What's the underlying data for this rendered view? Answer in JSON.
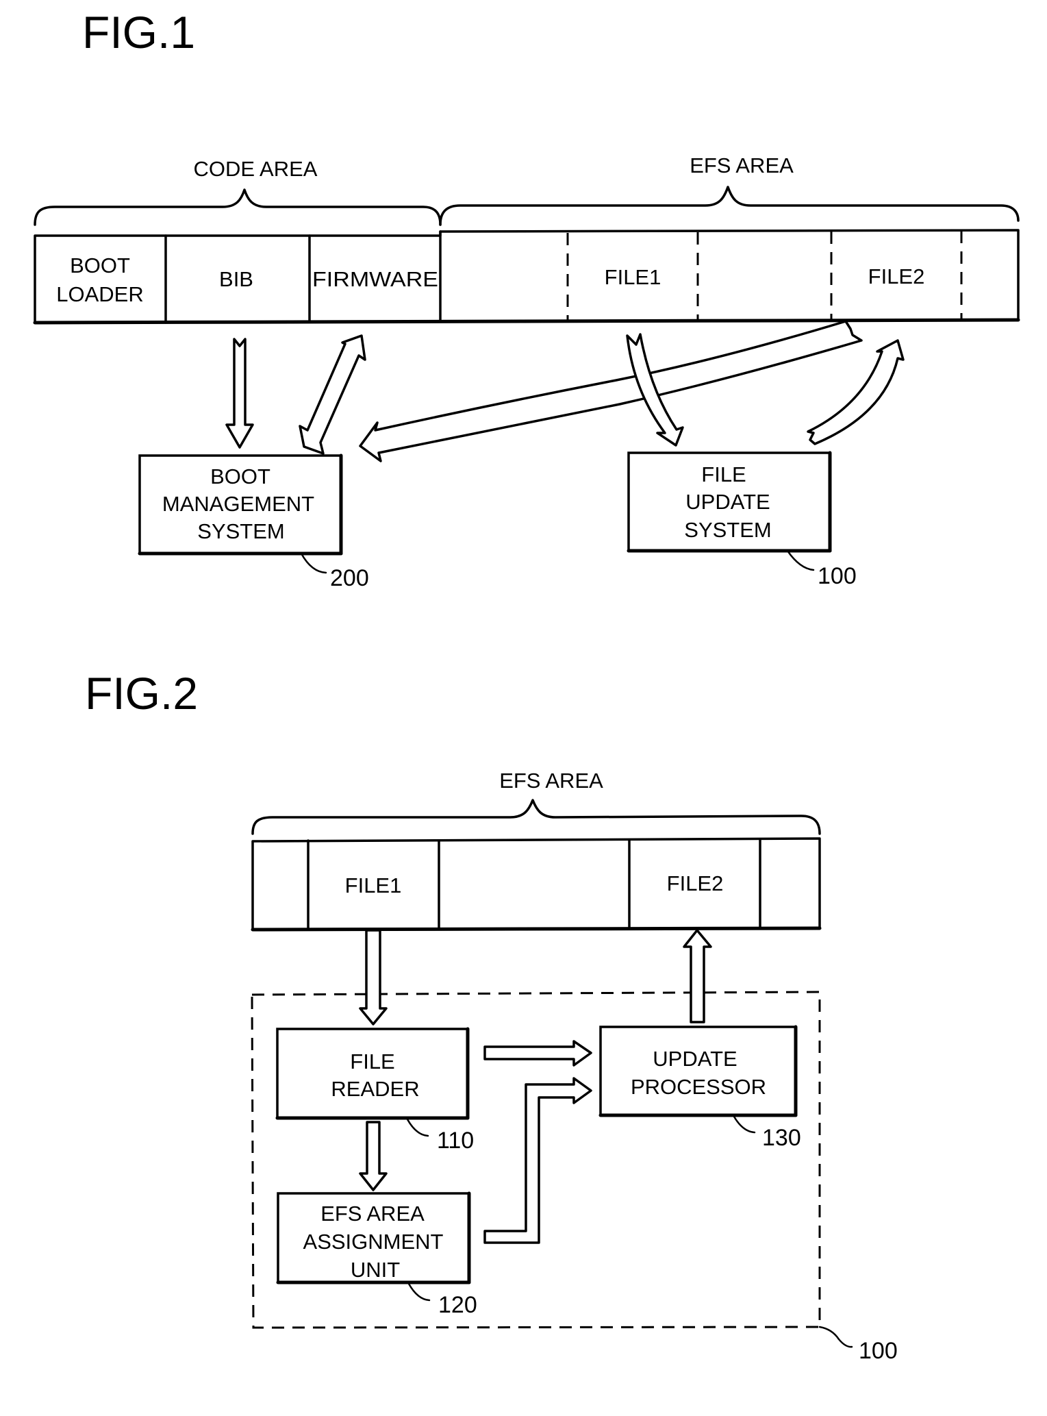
{
  "fig1": {
    "title": "FIG.1",
    "code_area_label": "CODE AREA",
    "efs_area_label": "EFS AREA",
    "code_segments": [
      {
        "lines": [
          "BOOT",
          "LOADER"
        ]
      },
      {
        "lines": [
          "BIB"
        ]
      },
      {
        "lines": [
          "FIRMWARE"
        ]
      }
    ],
    "efs_segments": [
      "",
      "FILE1",
      "",
      "FILE2",
      ""
    ],
    "boot_management_box": {
      "lines": [
        "BOOT",
        "MANAGEMENT",
        "SYSTEM"
      ],
      "ref": "200"
    },
    "file_update_box": {
      "lines": [
        "FILE",
        "UPDATE",
        "SYSTEM"
      ],
      "ref": "100"
    }
  },
  "fig2": {
    "title": "FIG.2",
    "efs_area_label": "EFS AREA",
    "efs_segments": [
      "",
      "FILE1",
      "",
      "FILE2",
      ""
    ],
    "file_reader_box": {
      "lines": [
        "FILE",
        "READER"
      ],
      "ref": "110"
    },
    "assignment_box": {
      "lines": [
        "EFS AREA",
        "ASSIGNMENT",
        "UNIT"
      ],
      "ref": "120"
    },
    "update_processor_box": {
      "lines": [
        "UPDATE",
        "PROCESSOR"
      ],
      "ref": "130"
    },
    "system_ref": "100"
  }
}
